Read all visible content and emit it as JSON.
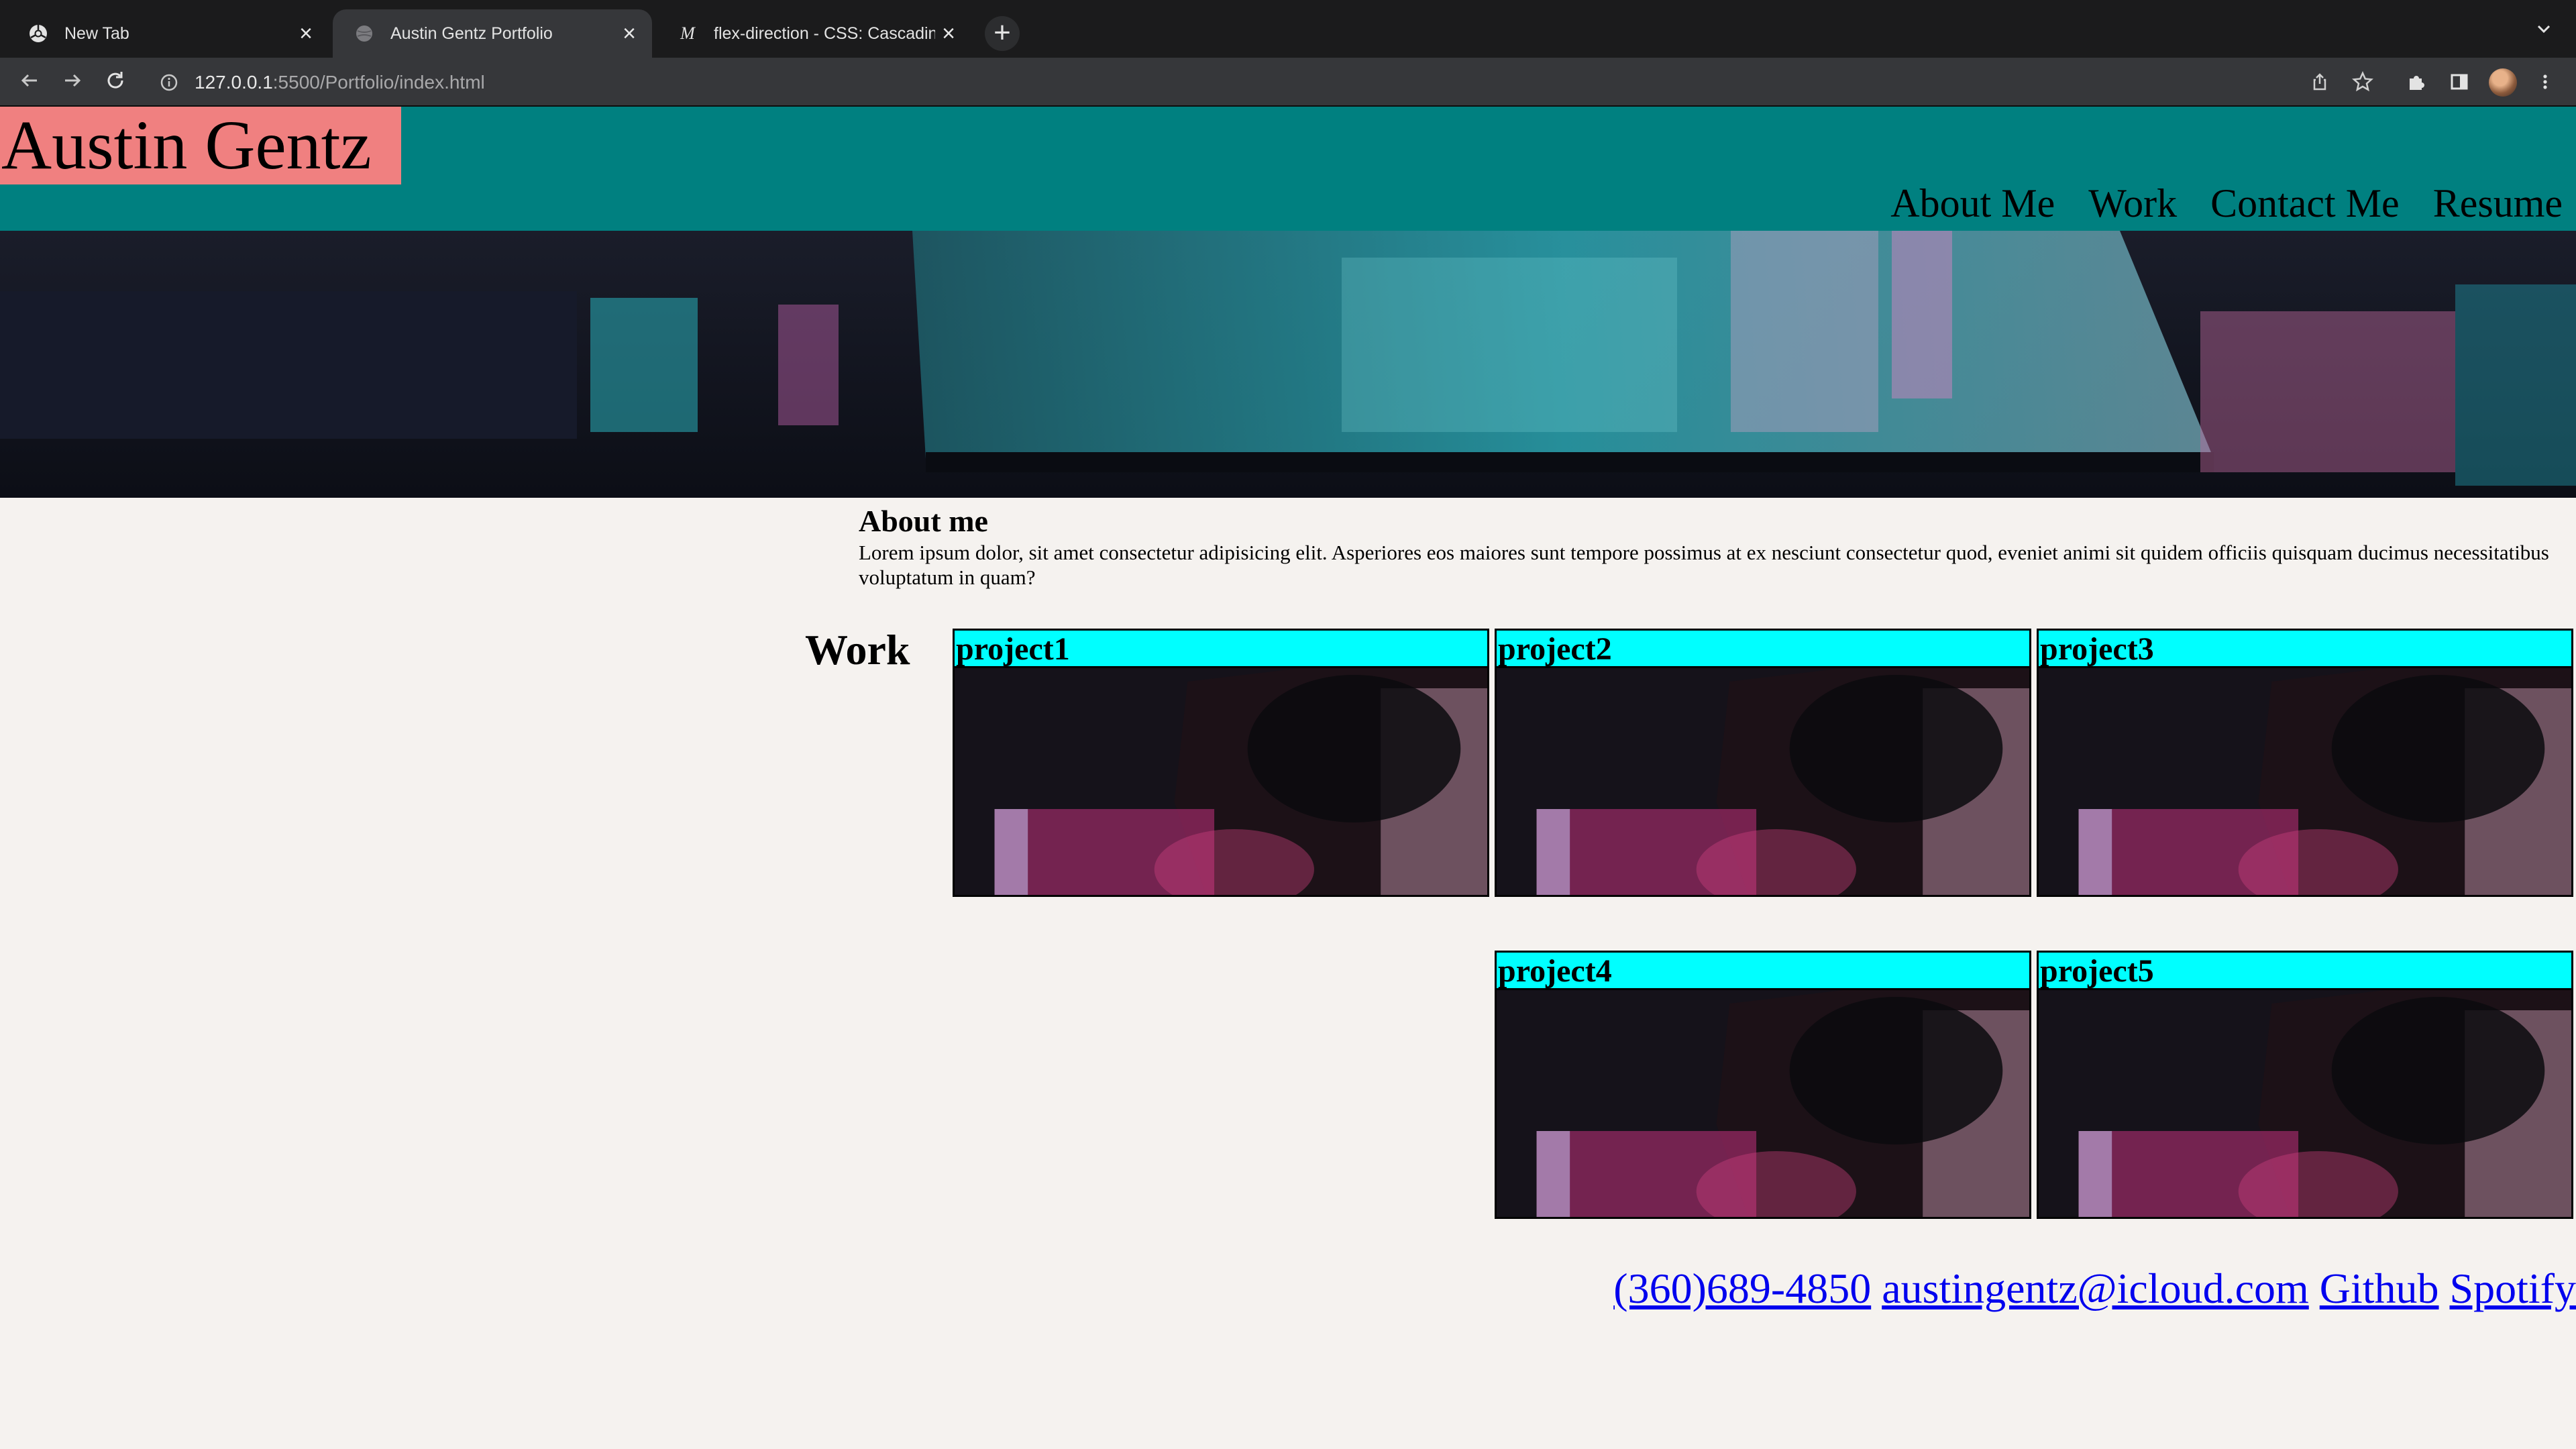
{
  "browser": {
    "tabs": [
      {
        "label": "New Tab",
        "icon": "chrome-icon",
        "active": false
      },
      {
        "label": "Austin Gentz Portfolio",
        "icon": "globe-icon",
        "active": true
      },
      {
        "label": "flex-direction - CSS: Cascading",
        "icon": "mdn-icon",
        "active": false
      }
    ],
    "url_host": "127.0.0.1",
    "url_path": ":5500/Portfolio/index.html"
  },
  "site": {
    "brand": "Austin Gentz",
    "nav": [
      "About Me",
      "Work",
      "Contact Me",
      "Resume"
    ],
    "about": {
      "heading": "About me",
      "body": "Lorem ipsum dolor, sit amet consectetur adipisicing elit. Asperiores eos maiores sunt tempore possimus at ex nesciunt consectetur quod, eveniet animi sit quidem officiis quisquam ducimus necessitatibus voluptatum in quam?"
    },
    "work": {
      "heading": "Work",
      "projects": [
        "project1",
        "project2",
        "project3",
        "project4",
        "project5"
      ]
    },
    "footer": [
      "(360)689-4850",
      "austingentz@icloud.com",
      "Github",
      "Spotify"
    ]
  },
  "colors": {
    "header_bg": "#008080",
    "brand_bg": "#f08080",
    "project_title_bg": "#00ffff",
    "link": "#0000ee",
    "page_bg": "#f5f2ef"
  }
}
